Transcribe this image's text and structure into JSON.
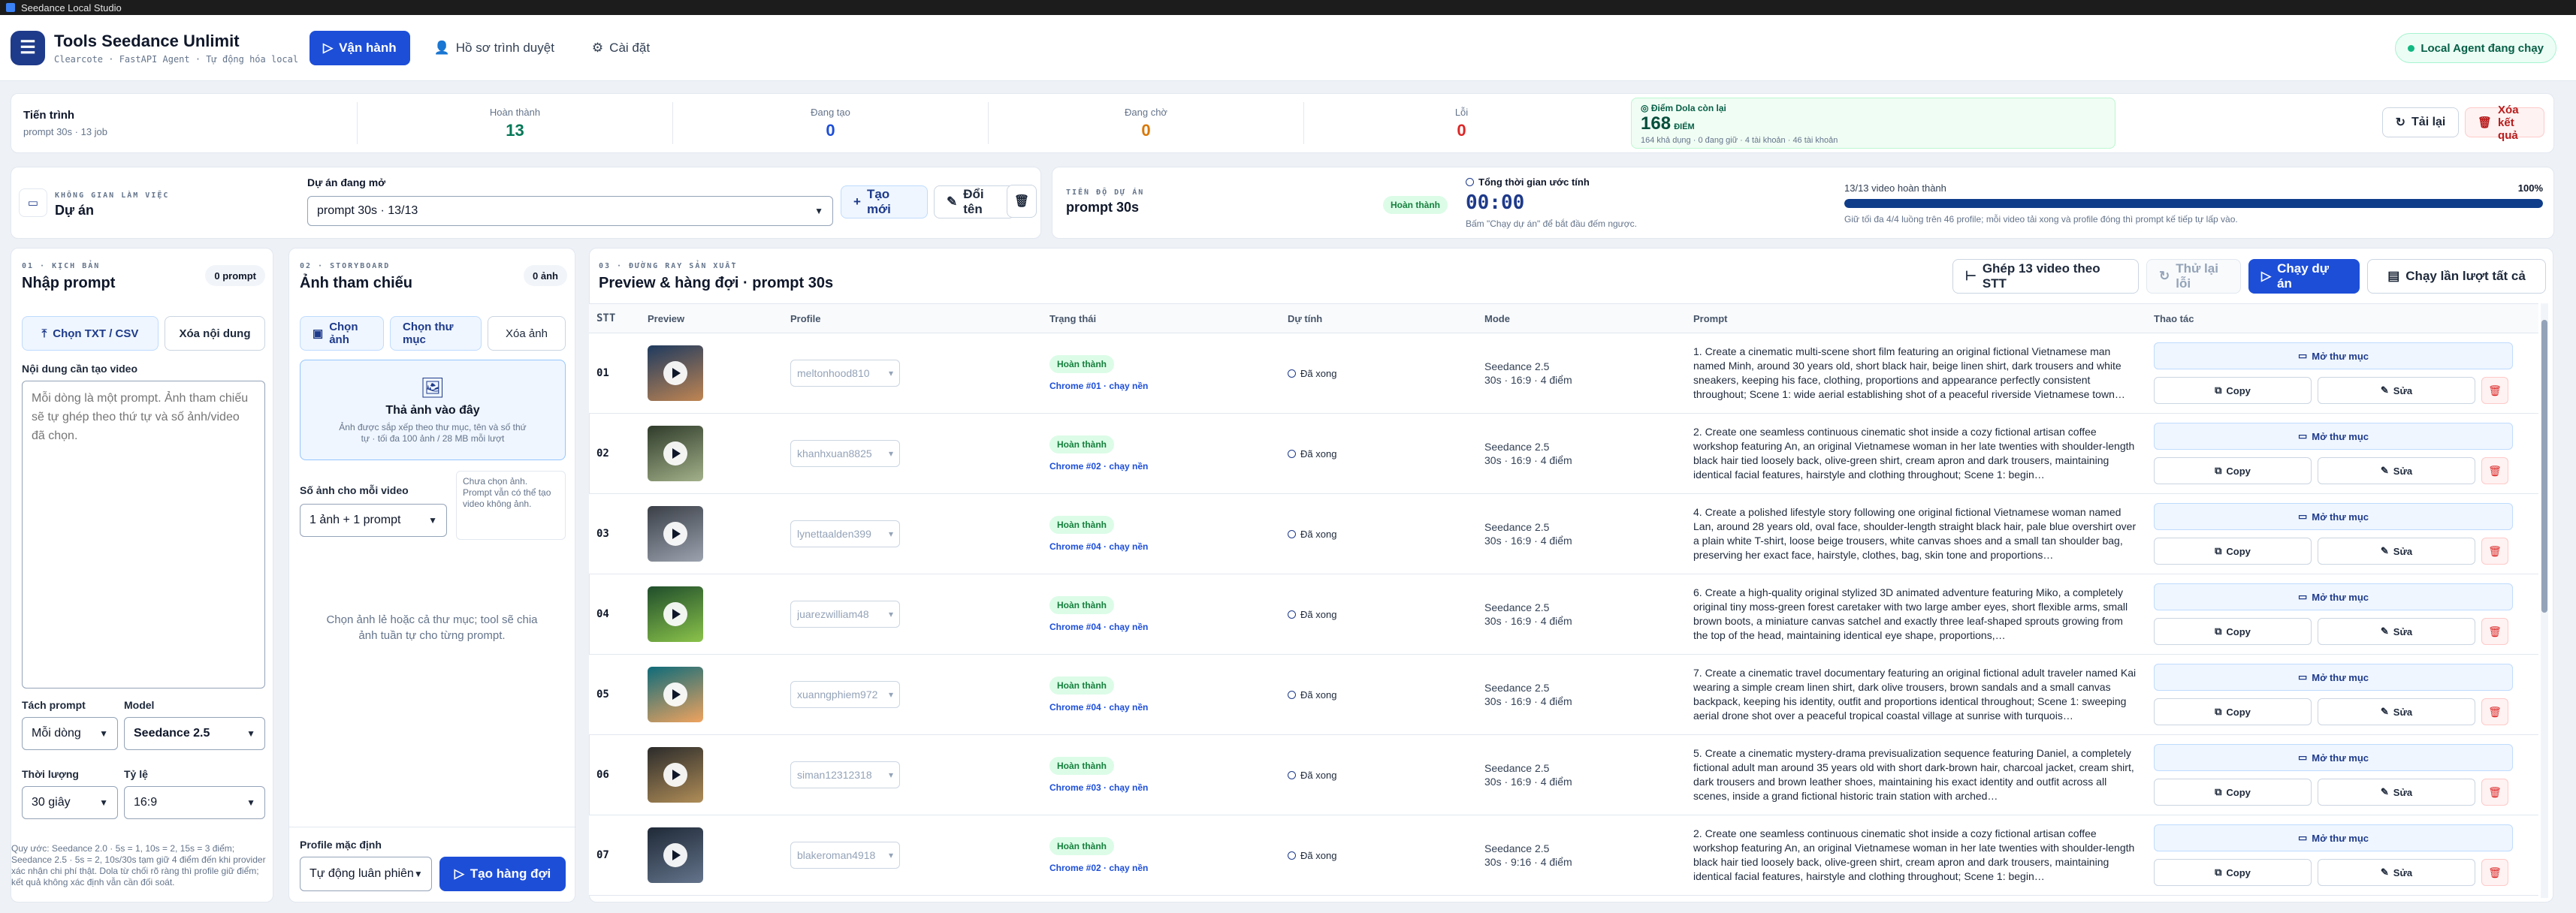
{
  "window": {
    "title": "Seedance Local Studio"
  },
  "header": {
    "title": "Tools Seedance Unlimit",
    "subtitle": "Clearcote · FastAPI Agent · Tự động hóa local",
    "nav": [
      {
        "label": "Vận hành",
        "icon": "play-icon",
        "active": true
      },
      {
        "label": "Hồ sơ trình duyệt",
        "icon": "user-icon",
        "active": false
      },
      {
        "label": "Cài đặt",
        "icon": "gear-icon",
        "active": false
      }
    ],
    "agent_status": "Local Agent đang chạy"
  },
  "stats": {
    "progress_label": "Tiến trình",
    "progress_sub": "prompt 30s · 13 job",
    "items": [
      {
        "label": "Hoàn thành",
        "value": "13",
        "color": "#047857"
      },
      {
        "label": "Đang tạo",
        "value": "0",
        "color": "#1d4ed8"
      },
      {
        "label": "Đang chờ",
        "value": "0",
        "color": "#d97706"
      },
      {
        "label": "Lỗi",
        "value": "0",
        "color": "#dc2626"
      }
    ],
    "points": {
      "label": "Điểm Dola còn lại",
      "value": "168",
      "unit": "ĐIỂM",
      "sub": "164 khả dụng · 0 đang giữ · 4 tài khoản · 46 tài khoản"
    },
    "reload_label": "Tải lại",
    "clear_label": "Xóa kết quả"
  },
  "workspace": {
    "kicker": "KHÔNG GIAN LÀM VIỆC",
    "title": "Dự án",
    "project_label": "Dự án đang mở",
    "project_value": "prompt 30s · 13/13",
    "new_label": "Tạo mới",
    "rename_label": "Đổi tên"
  },
  "project_progress": {
    "kicker": "TIẾN ĐỘ DỰ ÁN",
    "title": "prompt 30s",
    "badge": "Hoàn thành",
    "time_label": "Tổng thời gian ước tính",
    "time_value": "00:00",
    "time_hint": "Bấm \"Chạy dự án\" để bắt đầu đếm ngược.",
    "videos_label": "13/13 video hoàn thành",
    "percent_label": "100%",
    "percent": 100,
    "note": "Giữ tối đa 4/4 luồng trên 46 profile; mỗi video tải xong và profile đóng thì prompt kế tiếp tự lấp vào."
  },
  "script_panel": {
    "kicker": "01 · KỊCH BẢN",
    "title": "Nhập prompt",
    "count": "0 prompt",
    "choose_label": "Chọn TXT / CSV",
    "clear_label": "Xóa nội dung",
    "content_label": "Nội dung cần tạo video",
    "placeholder": "Mỗi dòng là một prompt. Ảnh tham chiếu sẽ tự ghép theo thứ tự và số ảnh/video đã chọn.",
    "split_label": "Tách prompt",
    "split_value": "Mỗi dòng",
    "model_label": "Model",
    "model_value": "Seedance 2.5",
    "duration_label": "Thời lượng",
    "duration_value": "30 giây",
    "ratio_label": "Tỷ lệ",
    "ratio_value": "16:9",
    "footnote": "Quy ước: Seedance 2.0 · 5s = 1, 10s = 2, 15s = 3 điểm; Seedance 2.5 · 5s = 2, 10s/30s tạm giữ 4 điểm đến khi provider xác nhận chi phí thật. Dola từ chối rõ ràng thì profile giữ điểm; kết quả không xác định vẫn cần đối soát."
  },
  "storyboard_panel": {
    "kicker": "02 · STORYBOARD",
    "title": "Ảnh tham chiếu",
    "count": "0 ảnh",
    "choose_images": "Chọn ảnh",
    "choose_folder": "Chọn thư mục",
    "clear_images": "Xóa ảnh",
    "drop_title": "Thả ảnh vào đây",
    "drop_sub": "Ảnh được sắp xếp theo thư mục, tên và số thứ tự · tối đa 100 ảnh / 28 MB mỗi lượt",
    "per_video_label": "Số ảnh cho mỗi video",
    "per_video_value": "1 ảnh + 1 prompt",
    "hint_box": "Chưa chọn ảnh. Prompt vẫn có thể tạo video không ảnh.",
    "empty_hint": "Chọn ảnh lẻ hoặc cả thư mục; tool sẽ chia ảnh tuần tự cho từng prompt.",
    "profile_label": "Profile mặc định",
    "profile_value": "Tự động luân phiên",
    "queue_label": "Tạo hàng đợi"
  },
  "queue_panel": {
    "kicker": "03 · ĐƯỜNG RAY SẢN XUẤT",
    "title": "Preview & hàng đợi · prompt 30s",
    "merge_label": "Ghép 13 video theo STT",
    "retry_label": "Thử lại lỗi",
    "run_label": "Chạy dự án",
    "run_all_label": "Chạy lần lượt tất cả",
    "columns": [
      "STT",
      "Preview",
      "Profile",
      "Trạng thái",
      "Dự tính",
      "Mode",
      "Prompt",
      "Thao tác"
    ],
    "open_folder_label": "Mở thư mục",
    "copy_label": "Copy",
    "edit_label": "Sửa",
    "rows": [
      {
        "stt": "01",
        "profile": "meltonhood810",
        "status": "Hoàn thành",
        "chrome": "Chrome #01 · chạy nền",
        "estimate": "Đã xong",
        "mode1": "Seedance 2.5",
        "mode2": "30s · 16:9 · 4 điểm",
        "prompt": "1. Create a cinematic multi-scene short film featuring an original fictional Vietnamese man named Minh, around 30 years old, short black hair, beige linen shirt, dark trousers and white sneakers, keeping his face, clothing, proportions and appearance perfectly consistent throughout; Scene 1: wide aerial establishing shot of a peaceful riverside Vietnamese town…",
        "thumb": [
          "#1e3a5f",
          "#c08552"
        ]
      },
      {
        "stt": "02",
        "profile": "khanhxuan8825",
        "status": "Hoàn thành",
        "chrome": "Chrome #02 · chạy nền",
        "estimate": "Đã xong",
        "mode1": "Seedance 2.5",
        "mode2": "30s · 16:9 · 4 điểm",
        "prompt": "2. Create one seamless continuous cinematic shot inside a cozy fictional artisan coffee workshop featuring An, an original Vietnamese woman in her late twenties with shoulder-length black hair tied loosely back, olive-green shirt, cream apron and dark trousers, maintaining identical facial features, hairstyle and clothing throughout; Scene 1: begin…",
        "thumb": [
          "#2f3b2a",
          "#a3b18a"
        ]
      },
      {
        "stt": "03",
        "profile": "lynettaalden399",
        "status": "Hoàn thành",
        "chrome": "Chrome #04 · chạy nền",
        "estimate": "Đã xong",
        "mode1": "Seedance 2.5",
        "mode2": "30s · 16:9 · 4 điểm",
        "prompt": "4. Create a polished lifestyle story following one original fictional Vietnamese woman named Lan, around 28 years old, oval face, shoulder-length straight black hair, pale blue overshirt over a plain white T-shirt, loose beige trousers, white canvas shoes and a small tan shoulder bag, preserving her exact face, hairstyle, clothes, bag, skin tone and proportions…",
        "thumb": [
          "#3a3f47",
          "#9ca3af"
        ]
      },
      {
        "stt": "04",
        "profile": "juarezwilliam48",
        "status": "Hoàn thành",
        "chrome": "Chrome #04 · chạy nền",
        "estimate": "Đã xong",
        "mode1": "Seedance 2.5",
        "mode2": "30s · 16:9 · 4 điểm",
        "prompt": "6. Create a high-quality original stylized 3D animated adventure featuring Miko, a completely original tiny moss-green forest caretaker with two large amber eyes, short flexible arms, small brown boots, a miniature canvas satchel and exactly three leaf-shaped sprouts growing from the top of the head, maintaining identical eye shape, proportions,…",
        "thumb": [
          "#1f4d2b",
          "#8bc34a"
        ]
      },
      {
        "stt": "05",
        "profile": "xuanngphiem972",
        "status": "Hoàn thành",
        "chrome": "Chrome #04 · chạy nền",
        "estimate": "Đã xong",
        "mode1": "Seedance 2.5",
        "mode2": "30s · 16:9 · 4 điểm",
        "prompt": "7. Create a cinematic travel documentary featuring an original fictional adult traveler named Kai wearing a simple cream linen shirt, dark olive trousers, brown sandals and a small canvas backpack, keeping his identity, outfit and proportions identical throughout; Scene 1: sweeping aerial drone shot over a peaceful tropical coastal village at sunrise with turquois…",
        "thumb": [
          "#0e6b7a",
          "#f0a35e"
        ]
      },
      {
        "stt": "06",
        "profile": "siman12312318",
        "status": "Hoàn thành",
        "chrome": "Chrome #03 · chạy nền",
        "estimate": "Đã xong",
        "mode1": "Seedance 2.5",
        "mode2": "30s · 16:9 · 4 điểm",
        "prompt": "5. Create a cinematic mystery-drama previsualization sequence featuring Daniel, a completely fictional adult man around 35 years old with short dark-brown hair, charcoal jacket, cream shirt, dark trousers and brown leather shoes, maintaining his exact identity and outfit across all scenes, inside a grand fictional historic train station with arched…",
        "thumb": [
          "#2b2b2b",
          "#b08d57"
        ]
      },
      {
        "stt": "07",
        "profile": "blakeroman4918",
        "status": "Hoàn thành",
        "chrome": "Chrome #02 · chạy nền",
        "estimate": "Đã xong",
        "mode1": "Seedance 2.5",
        "mode2": "30s · 9:16 · 4 điểm",
        "prompt": "2. Create one seamless continuous cinematic shot inside a cozy fictional artisan coffee workshop featuring An, an original Vietnamese woman in her late twenties with shoulder-length black hair tied loosely back, olive-green shirt, cream apron and dark trousers, maintaining identical facial features, hairstyle and clothing throughout; Scene 1: begin…",
        "thumb": [
          "#1f2937",
          "#64748b"
        ]
      }
    ]
  },
  "colors": {
    "accent": "#1d4ed8",
    "success": "#15803d",
    "danger": "#dc2626"
  }
}
